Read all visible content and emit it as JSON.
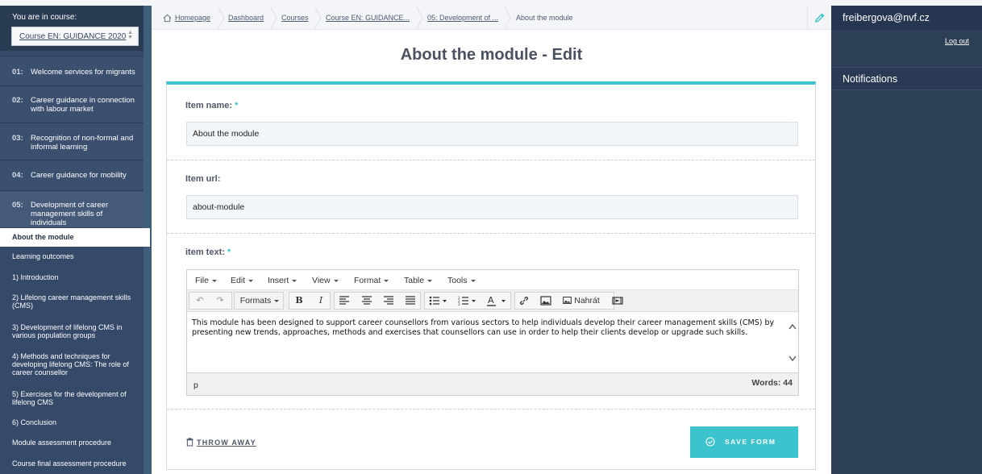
{
  "sidebar": {
    "course_label": "You are in course:",
    "course_value": "Course EN: GUIDANCE 2020",
    "modules": [
      {
        "num": "01:",
        "label": "Welcome services for migrants"
      },
      {
        "num": "02:",
        "label": "Career guidance in connection with labour market"
      },
      {
        "num": "03:",
        "label": "Recognition of non-formal and informal learning"
      },
      {
        "num": "04:",
        "label": "Career guidance for mobility"
      },
      {
        "num": "05:",
        "label": "Development of career management skills of individuals"
      }
    ],
    "items": [
      "About the module",
      "Learning outcomes",
      "1) Introduction",
      "2) Lifelong career management skills (CMS)",
      "3) Development of lifelong CMS in various population groups",
      "4) Methods and techniques for developing lifelong CMS: The role of career counsellor",
      "5) Exercises for the development of lifelong CMS",
      "6) Conclusion",
      "Module assessment procedure",
      "Course final assessment procedure"
    ]
  },
  "breadcrumb": [
    "Homepage",
    "Dashboard",
    "Courses",
    "Course EN: GUIDANCE...",
    "05: Development of ...",
    "About the module"
  ],
  "page_title": "About the module - Edit",
  "form": {
    "name_label": "Item name:",
    "name_value": "About the  module",
    "url_label": "Item url:",
    "url_value": "about-module",
    "text_label": "item text:",
    "required_mark": "*"
  },
  "editor": {
    "menus": [
      "File",
      "Edit",
      "Insert",
      "View",
      "Format",
      "Table",
      "Tools"
    ],
    "formats_label": "Formats",
    "upload_label": "Nahrát",
    "content": "This module has been designed to support career counsellors from various sectors to help individuals develop their career management skills (CMS) by presenting new trends, approaches, methods and exercises that counsellors can use in order to help their clients develop or upgrade such skills.",
    "path": "p",
    "word_count": "Words: 44"
  },
  "actions": {
    "throw_away": "THROW AWAY",
    "save": "SAVE FORM"
  },
  "user": {
    "email": "freibergova@nvf.cz",
    "logout": "Log out",
    "notifications": "Notifications"
  },
  "colors": {
    "accent": "#3cc3cd",
    "sidebar": "#344a68",
    "panel": "#2d3e57"
  }
}
